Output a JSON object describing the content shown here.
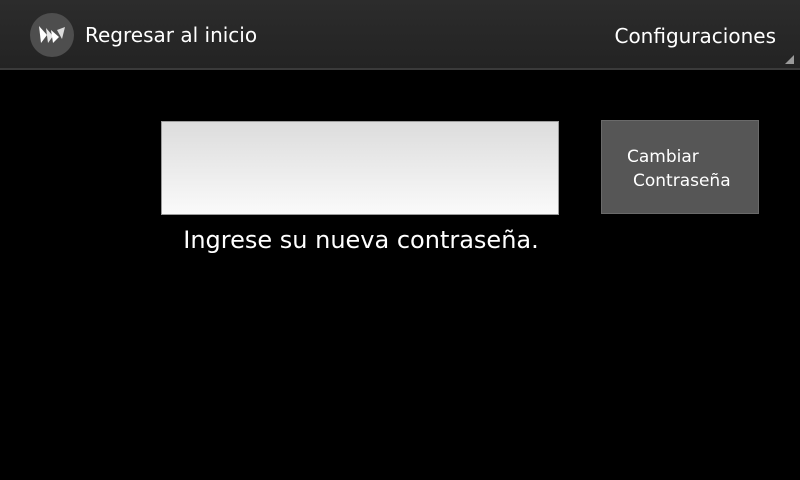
{
  "action_bar": {
    "logo_icon": "kivy-logo-icon",
    "back_label": "Regresar al inicio",
    "settings_label": "Configuraciones",
    "settings_icon": "dropdown-corner-icon"
  },
  "form": {
    "password_value": "",
    "hint": "Ingrese su nueva contraseña.",
    "change_button": {
      "line1": "Cambiar",
      "line2": "Contraseña"
    }
  },
  "colors": {
    "background": "#000000",
    "action_bar": "#2a2a2a",
    "button": "#565656",
    "input_top": "#dcdcdc",
    "input_bottom": "#fafafa"
  }
}
